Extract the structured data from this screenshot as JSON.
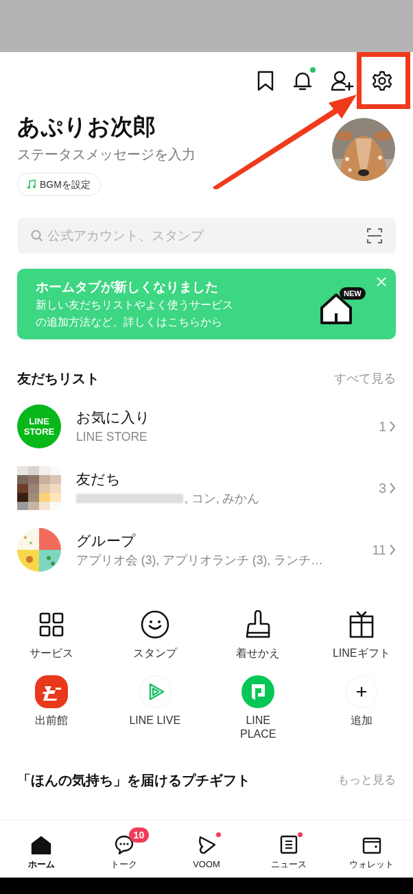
{
  "header": {
    "bell_dot": true
  },
  "profile": {
    "name": "あぷりお次郎",
    "status_placeholder": "ステータスメッセージを入力",
    "bgm_label": "BGMを設定"
  },
  "search": {
    "placeholder": "公式アカウント、スタンプ"
  },
  "banner": {
    "title": "ホームタブが新しくなりました",
    "body_lines": [
      "新しい友だちリストやよく使うサービス",
      "の追加方法など、詳しくはこちらから"
    ],
    "badge": "NEW"
  },
  "friends": {
    "title": "友だちリスト",
    "see_all": "すべて見る",
    "rows": [
      {
        "kind": "store",
        "avatar_lines": [
          "LINE",
          "STORE"
        ],
        "title": "お気に入り",
        "subtitle": "LINE STORE",
        "redacted": false,
        "count": "1"
      },
      {
        "kind": "mosaic",
        "title": "友だち",
        "subtitle": ", コン, みかん",
        "redacted": true,
        "count": "3"
      },
      {
        "kind": "group",
        "title": "グループ",
        "subtitle": "アプリオ会 (3), アプリオランチ (3), ランチ…",
        "redacted": false,
        "count": "11"
      }
    ]
  },
  "services": [
    {
      "kind": "grid",
      "label": "サービス"
    },
    {
      "kind": "smile",
      "label": "スタンプ"
    },
    {
      "kind": "brush",
      "label": "着せかえ"
    },
    {
      "kind": "gift",
      "label": "LINEギフト"
    },
    {
      "kind": "demaecan",
      "label": "出前館"
    },
    {
      "kind": "live",
      "label": "LINE LIVE"
    },
    {
      "kind": "place",
      "label": "LINE\nPLACE"
    },
    {
      "kind": "add",
      "label": "追加"
    }
  ],
  "gift_section": {
    "title": "「ほんの気持ち」を届けるプチギフト",
    "more": "もっと見る"
  },
  "nav": [
    {
      "kind": "home",
      "label": "ホーム",
      "selected": true,
      "dot": false
    },
    {
      "kind": "talk",
      "label": "トーク",
      "selected": false,
      "badge": "10",
      "dot": false
    },
    {
      "kind": "voom",
      "label": "VOOM",
      "selected": false,
      "dot": true
    },
    {
      "kind": "news",
      "label": "ニュース",
      "selected": false,
      "dot": true
    },
    {
      "kind": "wallet",
      "label": "ウォレット",
      "selected": false,
      "dot": false
    }
  ]
}
